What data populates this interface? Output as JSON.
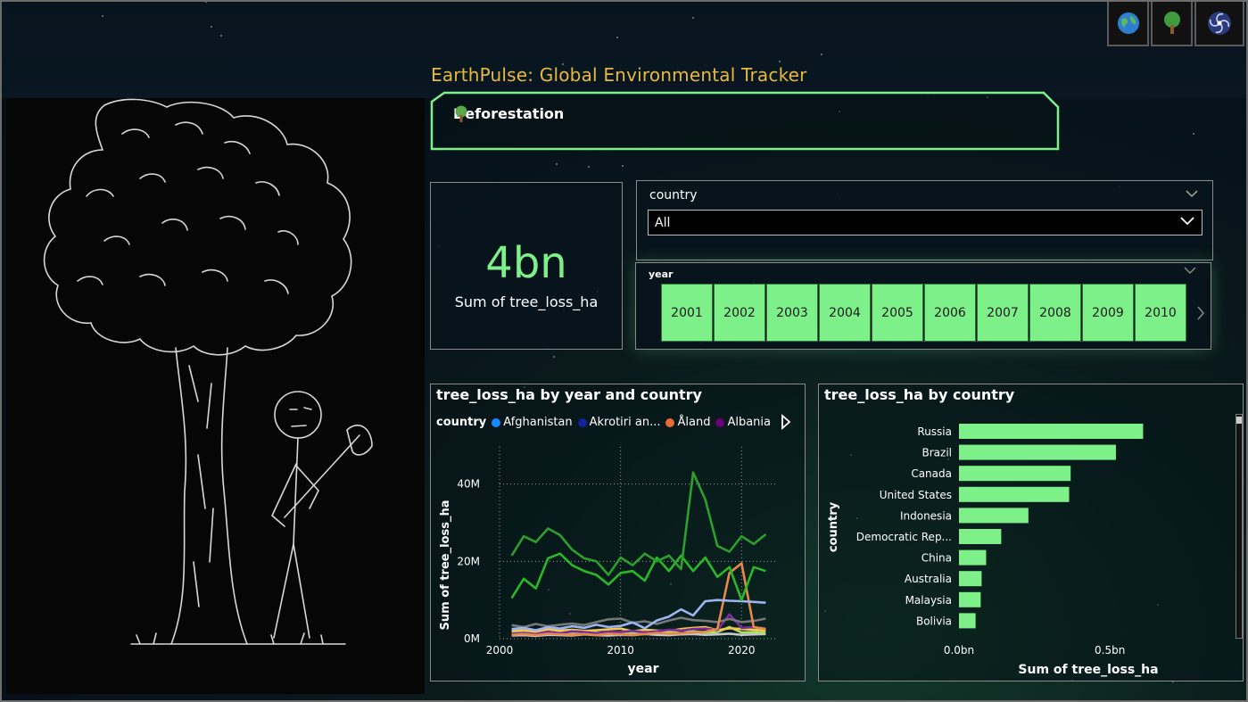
{
  "app_title": "EarthPulse: Global Environmental Tracker",
  "nav": {
    "icons": [
      {
        "name": "earth-icon"
      },
      {
        "name": "tree-icon"
      },
      {
        "name": "galaxy-icon"
      }
    ]
  },
  "section": {
    "label": "Deforestation",
    "icon": "tree-icon"
  },
  "kpi": {
    "value": "4bn",
    "label": "Sum of tree_loss_ha"
  },
  "country_slicer": {
    "title": "country",
    "selected": "All"
  },
  "year_slicer": {
    "title": "year",
    "years": [
      "2001",
      "2002",
      "2003",
      "2004",
      "2005",
      "2006",
      "2007",
      "2008",
      "2009",
      "2010"
    ]
  },
  "colors": {
    "accent": "#7ef08a",
    "title": "#e7b93c",
    "banner": "#7ef08a"
  },
  "line_chart": {
    "title": "tree_loss_ha by year and country",
    "legend_title": "country",
    "legend": [
      {
        "name": "Afghanistan",
        "color": "#118dff"
      },
      {
        "name": "Akrotiri an...",
        "color": "#12239e"
      },
      {
        "name": "Åland",
        "color": "#e66c37"
      },
      {
        "name": "Albania",
        "color": "#6b007b"
      }
    ]
  },
  "bar_chart": {
    "title": "tree_loss_ha by country"
  },
  "chart_data": [
    {
      "type": "line",
      "title": "tree_loss_ha by year and country",
      "xlabel": "year",
      "ylabel": "Sum of tree_loss_ha",
      "x_ticks": [
        2000,
        2010,
        2020
      ],
      "y_ticks": [
        "0M",
        "20M",
        "40M"
      ],
      "xlim": [
        2000,
        2023
      ],
      "ylim": [
        0,
        45000000
      ],
      "grid": true,
      "legend_placement": "top",
      "x": [
        2001,
        2002,
        2003,
        2004,
        2005,
        2006,
        2007,
        2008,
        2009,
        2010,
        2011,
        2012,
        2013,
        2014,
        2015,
        2016,
        2017,
        2018,
        2019,
        2020,
        2021,
        2022
      ],
      "series": [
        {
          "color": "#2e9e2e",
          "values": [
            21500000,
            26500000,
            25000000,
            28500000,
            26800000,
            23000000,
            20800000,
            20000000,
            16500000,
            21000000,
            19000000,
            22000000,
            20000000,
            21500000,
            18000000,
            43000000,
            36000000,
            24000000,
            22500000,
            26500000,
            24500000,
            27000000
          ]
        },
        {
          "color": "#28b828",
          "values": [
            10500000,
            15500000,
            13000000,
            20800000,
            22000000,
            19000000,
            17500000,
            16500000,
            14000000,
            17000000,
            17500000,
            15000000,
            21000000,
            17500000,
            21500000,
            17500000,
            21000000,
            16000000,
            18500000,
            10000000,
            18500000,
            17500000
          ]
        },
        {
          "color": "#9cb4f2",
          "values": [
            2500000,
            2800000,
            2200000,
            3000000,
            2600000,
            3200000,
            2800000,
            3600000,
            3000000,
            3300000,
            4200000,
            2700000,
            4700000,
            5700000,
            7600000,
            6000000,
            9700000,
            10000000,
            9800000,
            9700000,
            9500000,
            9300000
          ]
        },
        {
          "color": "#e8894a",
          "values": [
            1000000,
            1200000,
            900000,
            1300000,
            1100000,
            1000000,
            1200000,
            900000,
            1300000,
            1100000,
            1000000,
            1200000,
            1500000,
            1300000,
            1400000,
            1600000,
            1800000,
            2500000,
            17000000,
            19500000,
            3000000,
            2500000
          ]
        },
        {
          "color": "#777777",
          "values": [
            3500000,
            3000000,
            3800000,
            3200000,
            3600000,
            3900000,
            3500000,
            4300000,
            5000000,
            5200000,
            4100000,
            4500000,
            3800000,
            4700000,
            5400000,
            4800000,
            4600000,
            4300000,
            5100000,
            4300000,
            4600000,
            5200000
          ]
        },
        {
          "color": "#7a2a9e",
          "values": [
            1300000,
            1500000,
            1200000,
            1800000,
            1400000,
            1900000,
            1700000,
            1400000,
            1800000,
            1700000,
            2000000,
            1600000,
            1900000,
            2300000,
            2100000,
            2500000,
            2600000,
            2200000,
            6300000,
            2800000,
            3000000,
            2600000
          ]
        },
        {
          "color": "#f2c94c",
          "values": [
            2000000,
            2200000,
            1800000,
            2500000,
            2100000,
            2300000,
            2000000,
            2200000,
            2400000,
            2600000,
            1900000,
            2300000,
            2100000,
            2000000,
            2500000,
            2800000,
            3000000,
            2200000,
            2700000,
            2500000,
            2300000,
            2100000
          ]
        },
        {
          "color": "#a8e06a",
          "values": [
            1500000,
            1700000,
            1300000,
            1900000,
            1600000,
            1500000,
            1800000,
            1600000,
            1500000,
            1700000,
            1400000,
            1600000,
            1800000,
            1500000,
            2200000,
            1900000,
            1600000,
            1700000,
            3000000,
            1600000,
            1700000,
            1500000
          ]
        },
        {
          "color": "#c8c8c8",
          "values": [
            800000,
            900000,
            700000,
            1000000,
            900000,
            800000,
            1100000,
            900000,
            800000,
            1000000,
            900000,
            1200000,
            1000000,
            900000,
            1100000,
            1200000,
            1000000,
            1100000,
            1300000,
            1000000,
            1100000,
            1200000
          ]
        }
      ]
    },
    {
      "type": "bar",
      "orientation": "horizontal",
      "title": "tree_loss_ha by country",
      "xlabel": "Sum of tree_loss_ha",
      "ylabel": "country",
      "x_ticks": [
        "0.0bn",
        "0.5bn"
      ],
      "xlim": [
        0,
        0.86
      ],
      "grid": false,
      "color": "#7ef08a",
      "categories": [
        "Russia",
        "Brazil",
        "Canada",
        "United States",
        "Indonesia",
        "Democratic Rep...",
        "China",
        "Australia",
        "Malaysia",
        "Bolivia"
      ],
      "values": [
        0.61,
        0.52,
        0.37,
        0.365,
        0.23,
        0.14,
        0.09,
        0.075,
        0.072,
        0.055
      ]
    }
  ]
}
